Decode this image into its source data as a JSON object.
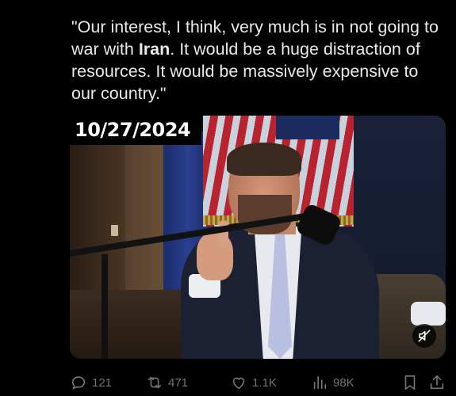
{
  "tweet": {
    "text_before": "\"Our interest, I think, very much is in not going to war with ",
    "text_bold": "Iran",
    "text_after": ". It would be a huge distraction of resources. It would be massively expensive to our country.\""
  },
  "media": {
    "date_overlay": "10/27/2024",
    "mute_icon": "muted-speaker-icon"
  },
  "actions": {
    "replies": "121",
    "reposts": "471",
    "likes": "1.1K",
    "views": "98K",
    "icons": {
      "reply": "reply-icon",
      "repost": "repost-icon",
      "like": "heart-icon",
      "views": "views-chart-icon",
      "bookmark": "bookmark-icon",
      "share": "share-icon"
    }
  },
  "colors": {
    "background": "#000000",
    "text": "#e7e9ea",
    "muted": "#71767b"
  }
}
